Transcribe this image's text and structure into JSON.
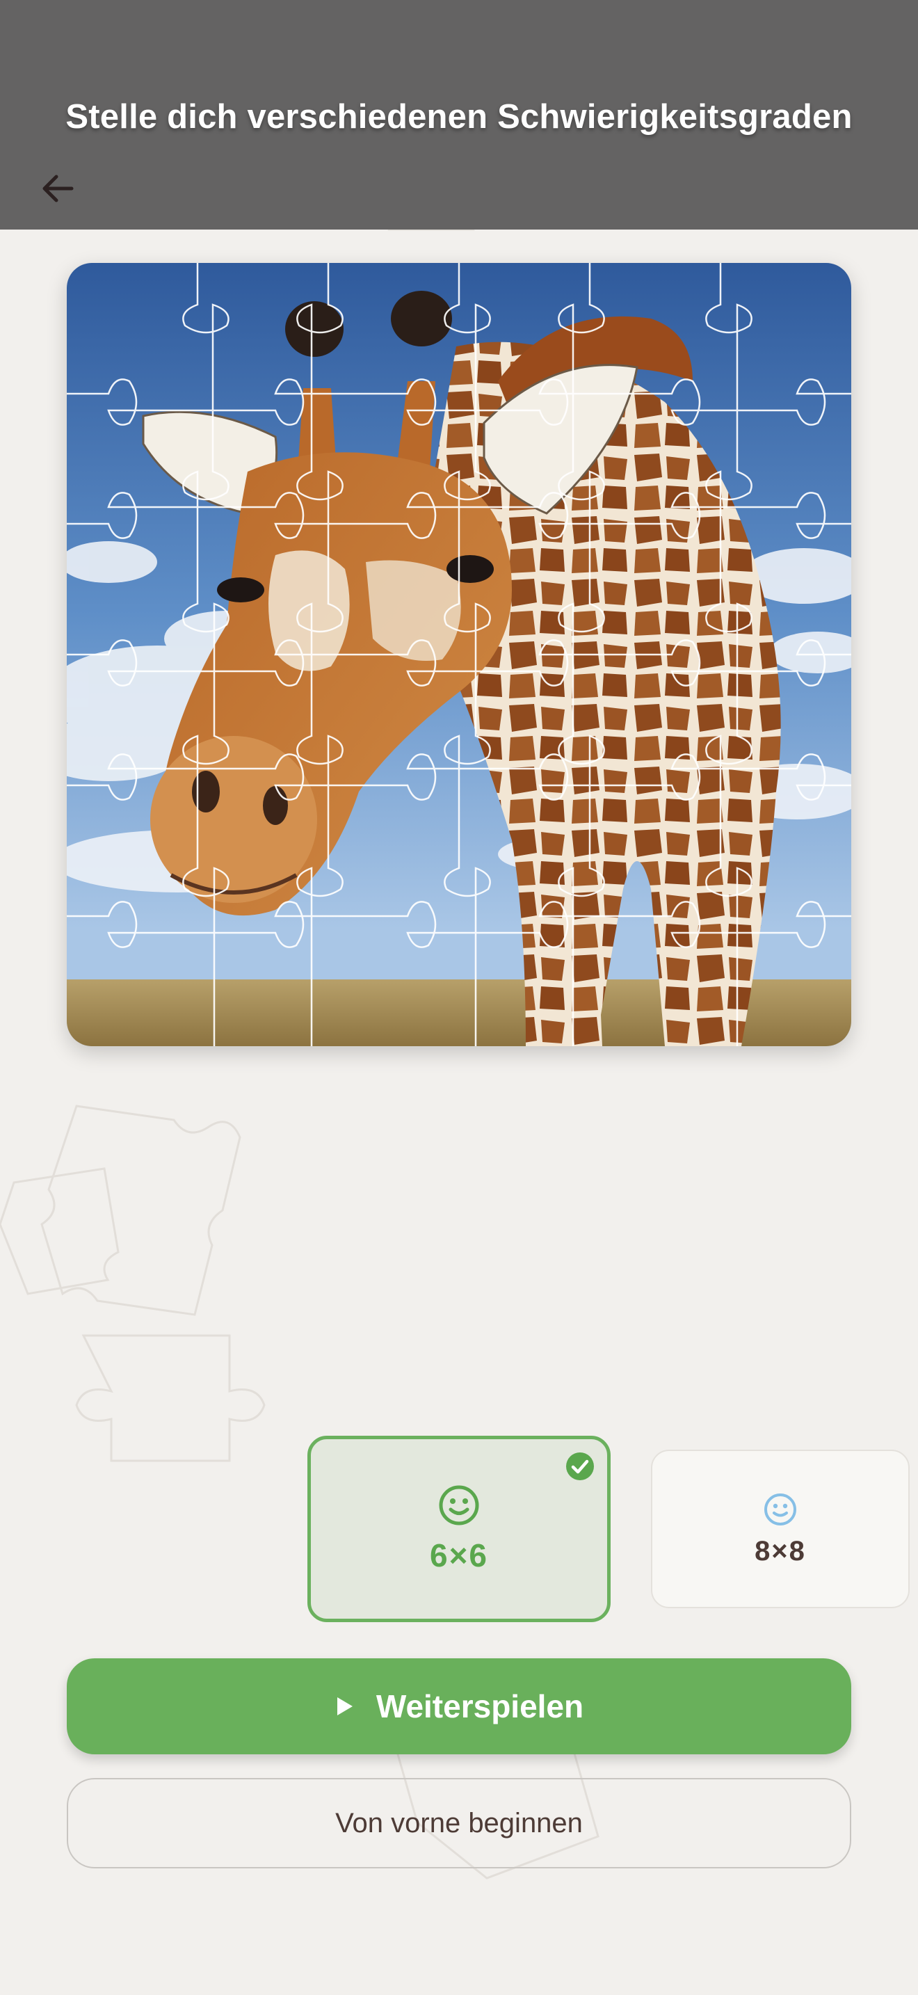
{
  "header": {
    "title": "Stelle dich verschiedenen Schwierigkeitsgraden",
    "back_icon": "arrow-left-icon"
  },
  "puzzle": {
    "subject": "giraffe",
    "grid_cols": 6,
    "grid_rows": 6
  },
  "difficulty": {
    "options": [
      {
        "label": "6×6",
        "icon": "smiley-icon",
        "selected": true
      },
      {
        "label": "8×8",
        "icon": "smiley-icon",
        "selected": false
      }
    ]
  },
  "actions": {
    "continue_label": "Weiterspielen",
    "continue_icon": "play-icon",
    "restart_label": "Von vorne beginnen"
  },
  "colors": {
    "header_bg": "#646363",
    "accent_green": "#69b05b",
    "selected_bg": "#e3e8dd",
    "text_dark": "#4d3b36",
    "smiley_blue": "#86bfe6"
  }
}
